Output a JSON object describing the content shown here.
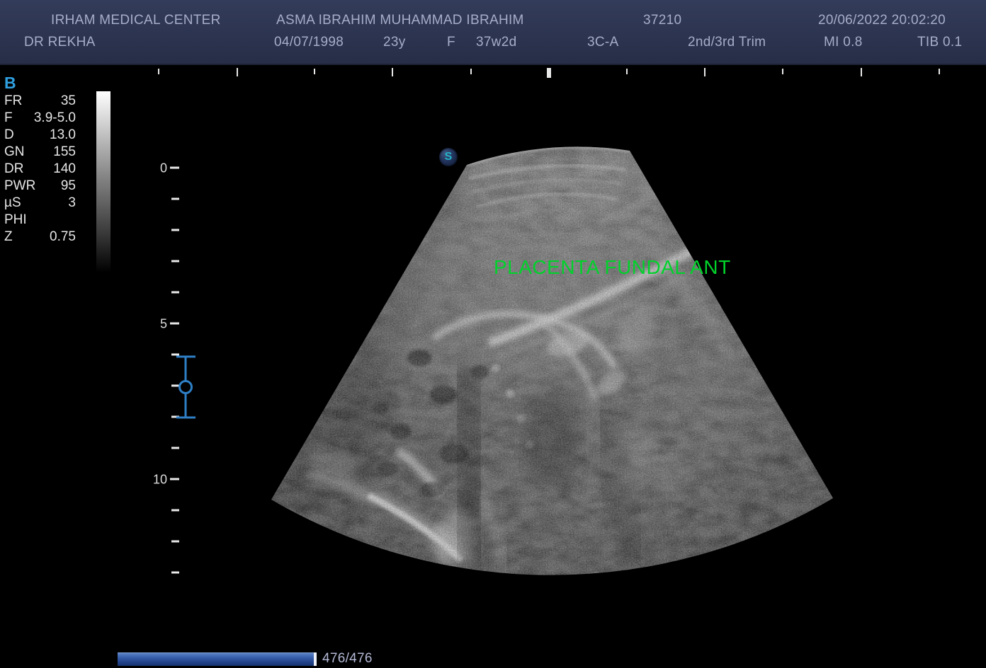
{
  "header": {
    "facility": "IRHAM MEDICAL CENTER",
    "physician": "DR REKHA",
    "patient_name": "ASMA IBRAHIM MUHAMMAD IBRAHIM",
    "patient_id": "37210",
    "datetime": "20/06/2022 20:02:20",
    "birth_date": "04/07/1998",
    "age": "23y",
    "sex": "F",
    "gestational_age": "37w2d",
    "probe": "3C-A",
    "preset": "2nd/3rd Trim",
    "mi": "MI 0.8",
    "tib": "TIB 0.1"
  },
  "mode_panel": {
    "mode": "B",
    "params": [
      {
        "label": "FR",
        "value": "35"
      },
      {
        "label": "F",
        "value": "3.9-5.0"
      },
      {
        "label": "D",
        "value": "13.0"
      },
      {
        "label": "GN",
        "value": "155"
      },
      {
        "label": "DR",
        "value": "140"
      },
      {
        "label": "PWR",
        "value": "95"
      },
      {
        "label": "µS",
        "value": "3"
      },
      {
        "label": "PHI",
        "value": ""
      },
      {
        "label": "Z",
        "value": "0.75"
      }
    ]
  },
  "depth_ruler": {
    "labels": [
      "0",
      "5",
      "10"
    ],
    "depth_cm": 13
  },
  "image": {
    "annotation": "PLACENTA FUNDAL ANT",
    "orientation_marker": "S"
  },
  "cine": {
    "frame_counter": "476/476",
    "progress_percent": 100
  },
  "colors": {
    "accent-blue": "#2f9fe0",
    "annotation-green": "#00d22b",
    "focus-blue": "#2e7fc6",
    "header-text": "#a6adc9",
    "header-bg": "#2c3450",
    "progress-blue": "#23448c"
  }
}
